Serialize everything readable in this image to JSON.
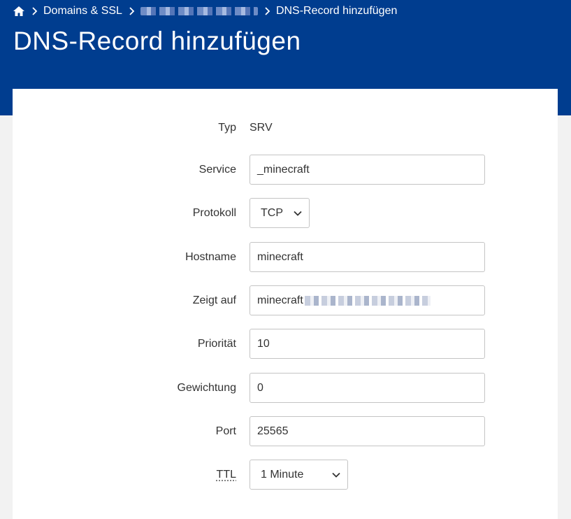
{
  "breadcrumb": {
    "home_icon": "home-icon",
    "items": [
      "Domains & SSL",
      "DNS-Record hinzufügen"
    ]
  },
  "page": {
    "title": "DNS-Record hinzufügen"
  },
  "form": {
    "typ": {
      "label": "Typ",
      "value": "SRV"
    },
    "service": {
      "label": "Service",
      "value": "_minecraft"
    },
    "protokoll": {
      "label": "Protokoll",
      "value": "TCP"
    },
    "hostname": {
      "label": "Hostname",
      "value": "minecraft"
    },
    "zeigt_auf": {
      "label": "Zeigt auf",
      "value": "minecraft"
    },
    "prioritaet": {
      "label": "Priorität",
      "value": "10"
    },
    "gewichtung": {
      "label": "Gewichtung",
      "value": "0"
    },
    "port": {
      "label": "Port",
      "value": "25565"
    },
    "ttl": {
      "label": "TTL",
      "value": "1 Minute"
    }
  },
  "colors": {
    "header": "#003d8f",
    "panel": "#ffffff",
    "background": "#f2f2f2"
  }
}
